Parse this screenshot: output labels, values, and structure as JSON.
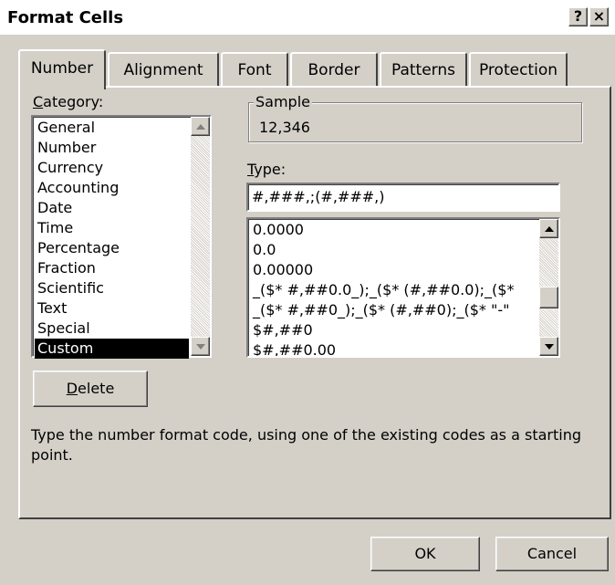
{
  "dialog": {
    "title": "Format Cells",
    "help_button": "?",
    "close_button": "×"
  },
  "tabs": [
    {
      "label": "Number",
      "active": true
    },
    {
      "label": "Alignment",
      "active": false
    },
    {
      "label": "Font",
      "active": false
    },
    {
      "label": "Border",
      "active": false
    },
    {
      "label": "Patterns",
      "active": false
    },
    {
      "label": "Protection",
      "active": false
    }
  ],
  "category": {
    "label": "Category:",
    "items": [
      "General",
      "Number",
      "Currency",
      "Accounting",
      "Date",
      "Time",
      "Percentage",
      "Fraction",
      "Scientific",
      "Text",
      "Special",
      "Custom"
    ],
    "selected": "Custom"
  },
  "sample": {
    "label": "Sample",
    "value": "12,346"
  },
  "type": {
    "label": "Type:",
    "value": "#,###,;(#,###,)",
    "options": [
      "0.0000",
      "0.0",
      "0.00000",
      "_($* #,##0.0_);_($* (#,##0.0);_($*",
      "_($* #,##0_);_($* (#,##0);_($* \"-\"",
      "$#,##0",
      "$#,##0.00"
    ]
  },
  "buttons": {
    "delete": "Delete",
    "ok": "OK",
    "cancel": "Cancel"
  },
  "description": "Type the number format code, using one of the existing codes as a starting point."
}
